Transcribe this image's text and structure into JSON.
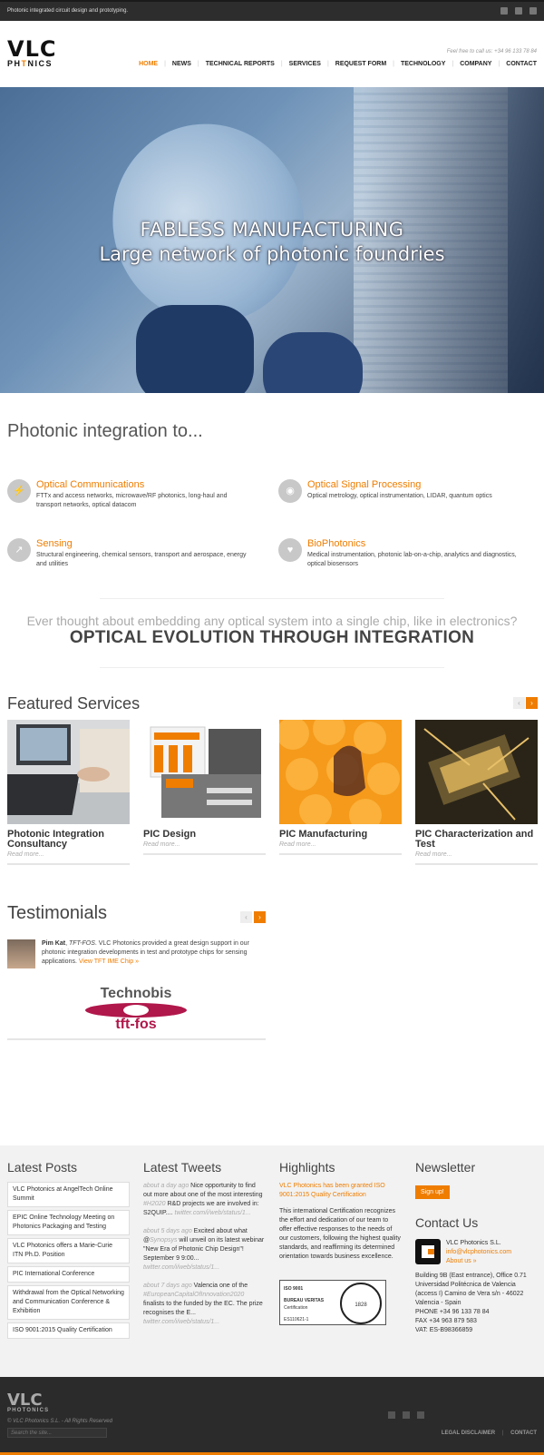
{
  "topbar": {
    "tagline": "Photonic integrated circuit design and prototyping.",
    "social": [
      "flickr-icon",
      "linkedin-icon",
      "youtube-icon"
    ]
  },
  "header": {
    "logo_top": "VLC",
    "logo_bottom_a": "PH",
    "logo_bottom_b": "T",
    "logo_bottom_c": "NICS",
    "call_us": "Feel free to call us: +34 96 133 78 84",
    "nav": [
      "HOME",
      "NEWS",
      "TECHNICAL REPORTS",
      "SERVICES",
      "REQUEST FORM",
      "TECHNOLOGY",
      "COMPANY",
      "CONTACT"
    ]
  },
  "hero": {
    "line1": "FABLESS MANUFACTURING",
    "line2": "Large network of photonic foundries"
  },
  "integration": {
    "heading": "Photonic integration to...",
    "features": [
      {
        "icon": "lightning-icon",
        "title": "Optical Communications",
        "desc": "FTTx and access networks, microwave/RF photonics, long-haul and transport networks, optical datacom"
      },
      {
        "icon": "signal-icon",
        "title": "Optical Signal Processing",
        "desc": "Optical metrology, optical instrumentation, LIDAR, quantum optics"
      },
      {
        "icon": "arrow-icon",
        "title": "Sensing",
        "desc": "Structural engineering, chemical sensors, transport and aerospace, energy and utilities"
      },
      {
        "icon": "heart-icon",
        "title": "BioPhotonics",
        "desc": "Medical instrumentation, photonic lab-on-a-chip, analytics and diagnostics, optical biosensors"
      }
    ]
  },
  "quote": {
    "line1": "Ever thought about embedding any optical system into a single chip, like in electronics?",
    "line2": "OPTICAL EVOLUTION THROUGH INTEGRATION"
  },
  "services": {
    "heading": "Featured Services",
    "items": [
      {
        "name": "Photonic Integration Consultancy",
        "more": "Read more..."
      },
      {
        "name": "PIC Design",
        "more": "Read more..."
      },
      {
        "name": "PIC Manufacturing",
        "more": "Read more..."
      },
      {
        "name": "PIC Characterization and Test",
        "more": "Read more..."
      }
    ]
  },
  "testimonials": {
    "heading": "Testimonials",
    "name": "Pim Kat",
    "company": "TFT-FOS",
    "text": "VLC Photonics provided a great design support in our photonic integration developments in test and prototype chips for sensing applications.",
    "link": "View TFT IME Chip »",
    "logo_top": "Technobis",
    "logo_bottom": "tft-fos"
  },
  "footer": {
    "posts_heading": "Latest Posts",
    "posts": [
      "VLC Photonics at AngelTech Online Summit",
      "EPIC Online Technology Meeting on Photonics Packaging and Testing",
      "VLC Photonics offers a Marie-Curie ITN Ph.D. Position",
      "PIC International Conference",
      "Withdrawal from the Optical Networking and Communication Conference & Exhibition",
      "ISO 9001:2015 Quality Certification"
    ],
    "tweets_heading": "Latest Tweets",
    "tweets": [
      {
        "ago": "about a day ago",
        "a": "Nice opportunity to find out more about one of the most interesting",
        "hash": "#H2020",
        "b": "R&D projects we are involved in: S2QUIP.... ",
        "link": "twitter.com/i/web/status/1..."
      },
      {
        "ago": "about 5 days ago",
        "a": "Excited about what @",
        "hash": "Synopsys",
        "b": "will unveil on its latest webinar \"New Era of Photonic Chip Design\"! September 9 9:00... ",
        "link": "twitter.com/i/web/status/1..."
      },
      {
        "ago": "about 7 days ago",
        "a": "Valencia one of the",
        "hash": "#EuropeanCapitalOfInnovation2020",
        "b": "finalists to the funded by the EC. The prize recognises the E... ",
        "link": "twitter.com/i/web/status/1..."
      }
    ],
    "highlights_heading": "Highlights",
    "highlight_link": "VLC Photonics has been granted ISO 9001:2015 Quality Certification",
    "highlight_text": "This international Certification recognizes the effort and dedication of our team to offer effective responses to the needs of our customers, following the highest quality standards, and reaffirming its determined orientation towards business excellence.",
    "cert_iso": "ISO 9001",
    "cert_bv": "BUREAU VERITAS",
    "cert_label": "Certification",
    "cert_no": "ES110621-1",
    "cert_year": "1828",
    "newsletter_heading": "Newsletter",
    "signup": "Sign up!",
    "contact_heading": "Contact Us",
    "company": "VLC Photonics S.L.",
    "email": "info@vlcphotonics.com",
    "about": "About us »",
    "address": "Building 9B (East entrance), Office 0.71 Universidad Politécnica de Valencia (access I) Camino de Vera s/n - 46022 Valencia - Spain",
    "phone": "PHONE +34 96 133 78 84",
    "fax": "FAX +34 963 879 583",
    "vat": "VAT: ES-B98366859"
  },
  "bottom": {
    "logo_top": "VLC",
    "logo_bottom": "PHOTONICS",
    "copyright": "© VLC Photonics S.L. - All Rights Reserved",
    "search_placeholder": "Search the site...",
    "links": [
      "LEGAL DISCLAIMER",
      "CONTACT"
    ]
  },
  "colors": {
    "accent": "#ef7d00",
    "dark": "#2b2b2b"
  }
}
